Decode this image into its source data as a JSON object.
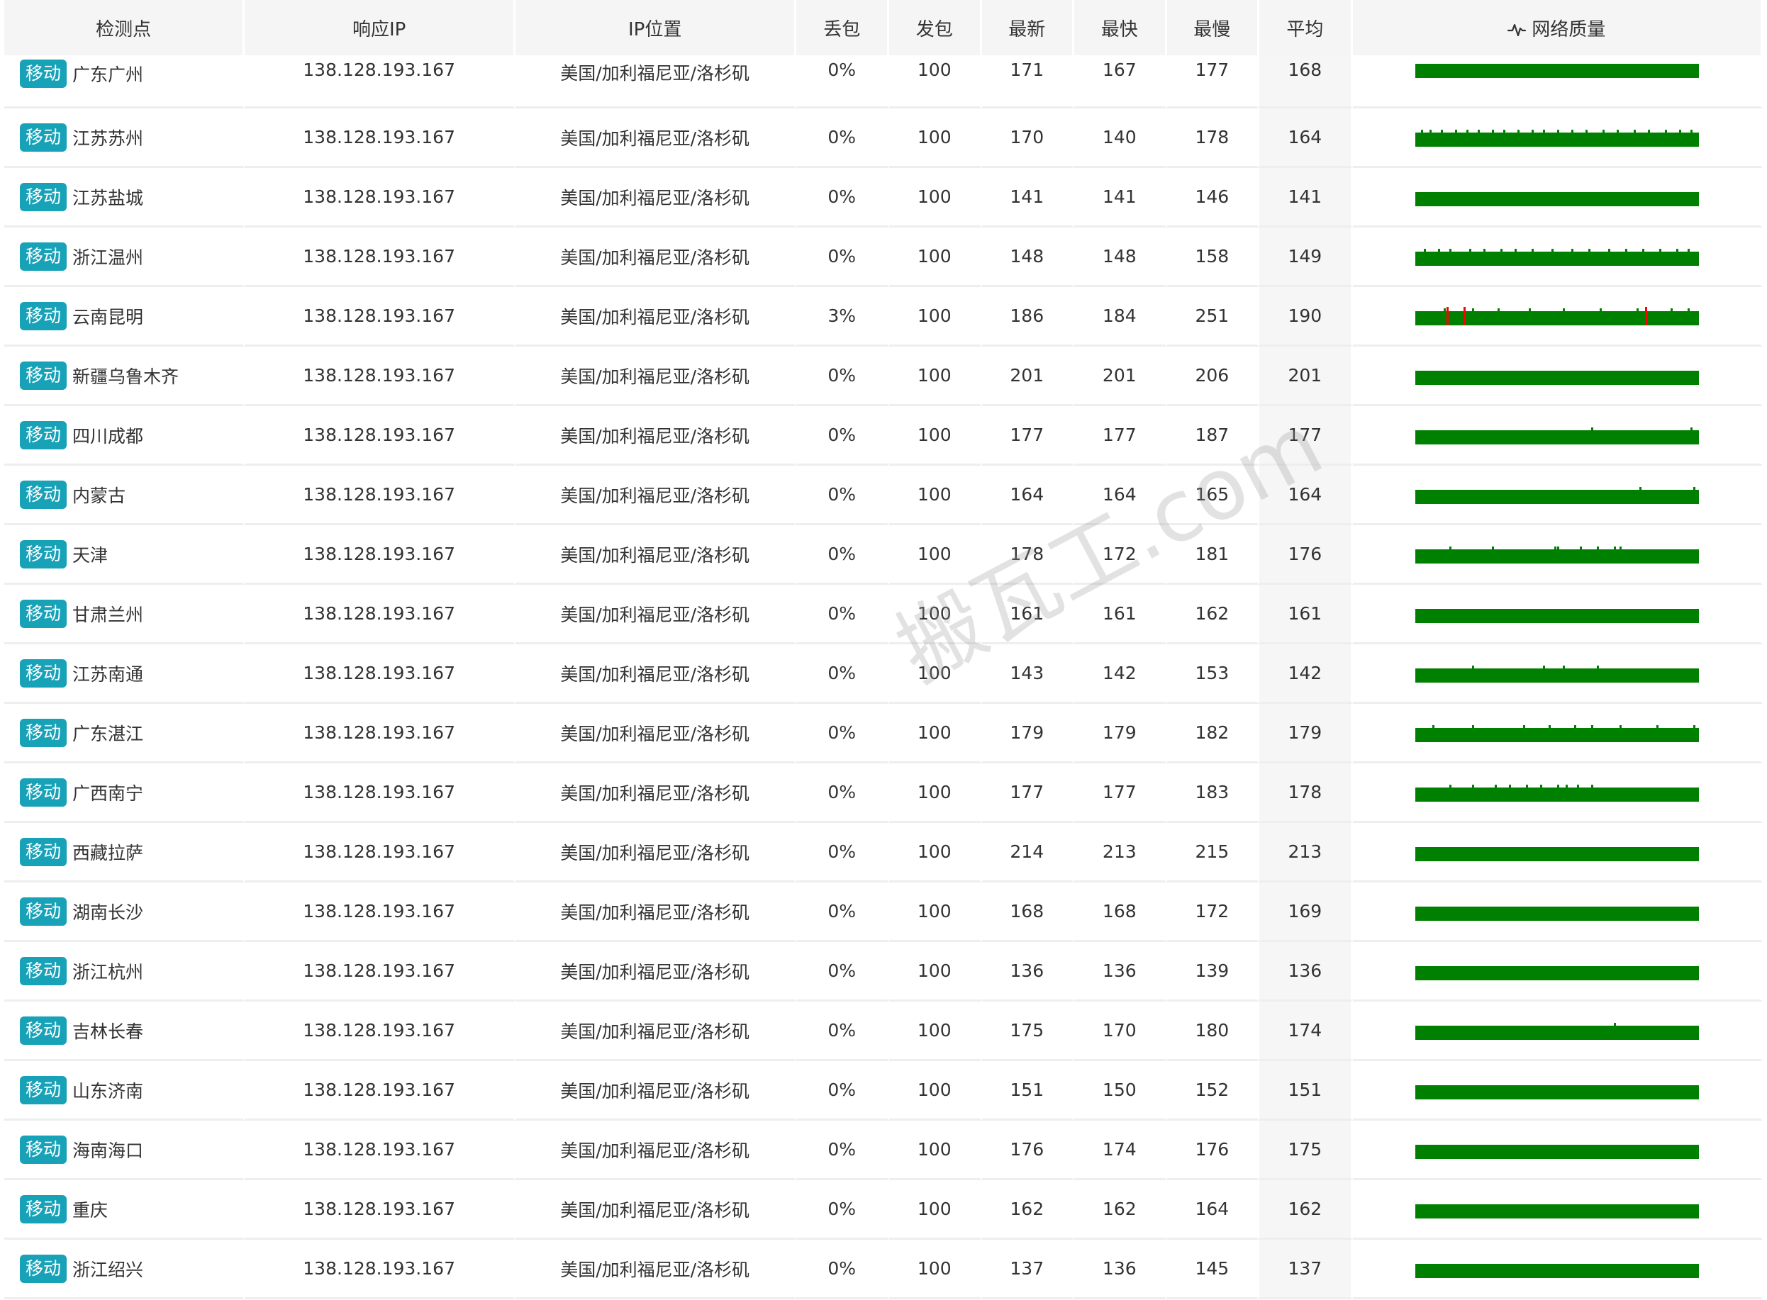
{
  "headers": {
    "node": "检测点",
    "ip": "响应IP",
    "location": "IP位置",
    "loss": "丢包",
    "sent": "发包",
    "latest": "最新",
    "fastest": "最快",
    "slowest": "最慢",
    "average": "平均",
    "quality": "网络质量"
  },
  "icons": {
    "quality_header": "pulse-icon"
  },
  "colors": {
    "badge": "#17a2b8",
    "ok": "#008000",
    "loss": "#ff0000"
  },
  "watermark": "搬瓦工.com",
  "rows": [
    {
      "isp": "移动",
      "node": "广东广州",
      "ip": "138.128.193.167",
      "loc": "美国/加利福尼亚/洛杉矶",
      "loss": "0%",
      "sent": "100",
      "latest": "171",
      "fastest": "167",
      "slowest": "177",
      "avg": "168",
      "spikes": [],
      "lost": []
    },
    {
      "isp": "移动",
      "node": "江苏苏州",
      "ip": "138.128.193.167",
      "loc": "美国/加利福尼亚/洛杉矶",
      "loss": "0%",
      "sent": "100",
      "latest": "170",
      "fastest": "140",
      "slowest": "178",
      "avg": "164",
      "spikes": [
        0.02,
        0.05,
        0.09,
        0.14,
        0.18,
        0.22,
        0.27,
        0.31,
        0.36,
        0.41,
        0.45,
        0.5,
        0.55,
        0.6,
        0.66,
        0.71,
        0.77,
        0.82,
        0.88,
        0.93,
        0.97
      ],
      "lost": []
    },
    {
      "isp": "移动",
      "node": "江苏盐城",
      "ip": "138.128.193.167",
      "loc": "美国/加利福尼亚/洛杉矶",
      "loss": "0%",
      "sent": "100",
      "latest": "141",
      "fastest": "141",
      "slowest": "146",
      "avg": "141",
      "spikes": [],
      "lost": []
    },
    {
      "isp": "移动",
      "node": "浙江温州",
      "ip": "138.128.193.167",
      "loc": "美国/加利福尼亚/洛杉矶",
      "loss": "0%",
      "sent": "100",
      "latest": "148",
      "fastest": "148",
      "slowest": "158",
      "avg": "149",
      "spikes": [
        0.03,
        0.08,
        0.12,
        0.19,
        0.24,
        0.3,
        0.35,
        0.41,
        0.48,
        0.55,
        0.61,
        0.68,
        0.74,
        0.8,
        0.86,
        0.92,
        0.96
      ],
      "lost": []
    },
    {
      "isp": "移动",
      "node": "云南昆明",
      "ip": "138.128.193.167",
      "loc": "美国/加利福尼亚/洛杉矶",
      "loss": "3%",
      "sent": "100",
      "latest": "186",
      "fastest": "184",
      "slowest": "251",
      "avg": "190",
      "spikes": [
        0.1,
        0.2,
        0.29,
        0.4,
        0.52,
        0.65,
        0.78,
        0.9,
        0.96
      ],
      "lost": [
        0.11,
        0.17,
        0.81
      ]
    },
    {
      "isp": "移动",
      "node": "新疆乌鲁木齐",
      "ip": "138.128.193.167",
      "loc": "美国/加利福尼亚/洛杉矶",
      "loss": "0%",
      "sent": "100",
      "latest": "201",
      "fastest": "201",
      "slowest": "206",
      "avg": "201",
      "spikes": [],
      "lost": []
    },
    {
      "isp": "移动",
      "node": "四川成都",
      "ip": "138.128.193.167",
      "loc": "美国/加利福尼亚/洛杉矶",
      "loss": "0%",
      "sent": "100",
      "latest": "177",
      "fastest": "177",
      "slowest": "187",
      "avg": "177",
      "spikes": [
        0.62,
        0.97
      ],
      "lost": []
    },
    {
      "isp": "移动",
      "node": "内蒙古",
      "ip": "138.128.193.167",
      "loc": "美国/加利福尼亚/洛杉矶",
      "loss": "0%",
      "sent": "100",
      "latest": "164",
      "fastest": "164",
      "slowest": "165",
      "avg": "164",
      "spikes": [
        0.79,
        0.98
      ],
      "lost": []
    },
    {
      "isp": "移动",
      "node": "天津",
      "ip": "138.128.193.167",
      "loc": "美国/加利福尼亚/洛杉矶",
      "loss": "0%",
      "sent": "100",
      "latest": "178",
      "fastest": "172",
      "slowest": "181",
      "avg": "176",
      "spikes": [
        0.12,
        0.27,
        0.49,
        0.5,
        0.58,
        0.64,
        0.7,
        0.72
      ],
      "lost": []
    },
    {
      "isp": "移动",
      "node": "甘肃兰州",
      "ip": "138.128.193.167",
      "loc": "美国/加利福尼亚/洛杉矶",
      "loss": "0%",
      "sent": "100",
      "latest": "161",
      "fastest": "161",
      "slowest": "162",
      "avg": "161",
      "spikes": [],
      "lost": []
    },
    {
      "isp": "移动",
      "node": "江苏南通",
      "ip": "138.128.193.167",
      "loc": "美国/加利福尼亚/洛杉矶",
      "loss": "0%",
      "sent": "100",
      "latest": "143",
      "fastest": "142",
      "slowest": "153",
      "avg": "142",
      "spikes": [
        0.2,
        0.45,
        0.52,
        0.64
      ],
      "lost": []
    },
    {
      "isp": "移动",
      "node": "广东湛江",
      "ip": "138.128.193.167",
      "loc": "美国/加利福尼亚/洛杉矶",
      "loss": "0%",
      "sent": "100",
      "latest": "179",
      "fastest": "179",
      "slowest": "182",
      "avg": "179",
      "spikes": [
        0.06,
        0.2,
        0.38,
        0.47,
        0.56,
        0.62,
        0.72,
        0.85,
        0.98
      ],
      "lost": []
    },
    {
      "isp": "移动",
      "node": "广西南宁",
      "ip": "138.128.193.167",
      "loc": "美国/加利福尼亚/洛杉矶",
      "loss": "0%",
      "sent": "100",
      "latest": "177",
      "fastest": "177",
      "slowest": "183",
      "avg": "178",
      "spikes": [
        0.12,
        0.2,
        0.28,
        0.33,
        0.39,
        0.44,
        0.5,
        0.53,
        0.57,
        0.62
      ],
      "lost": []
    },
    {
      "isp": "移动",
      "node": "西藏拉萨",
      "ip": "138.128.193.167",
      "loc": "美国/加利福尼亚/洛杉矶",
      "loss": "0%",
      "sent": "100",
      "latest": "214",
      "fastest": "213",
      "slowest": "215",
      "avg": "213",
      "spikes": [],
      "lost": []
    },
    {
      "isp": "移动",
      "node": "湖南长沙",
      "ip": "138.128.193.167",
      "loc": "美国/加利福尼亚/洛杉矶",
      "loss": "0%",
      "sent": "100",
      "latest": "168",
      "fastest": "168",
      "slowest": "172",
      "avg": "169",
      "spikes": [],
      "lost": []
    },
    {
      "isp": "移动",
      "node": "浙江杭州",
      "ip": "138.128.193.167",
      "loc": "美国/加利福尼亚/洛杉矶",
      "loss": "0%",
      "sent": "100",
      "latest": "136",
      "fastest": "136",
      "slowest": "139",
      "avg": "136",
      "spikes": [],
      "lost": []
    },
    {
      "isp": "移动",
      "node": "吉林长春",
      "ip": "138.128.193.167",
      "loc": "美国/加利福尼亚/洛杉矶",
      "loss": "0%",
      "sent": "100",
      "latest": "175",
      "fastest": "170",
      "slowest": "180",
      "avg": "174",
      "spikes": [
        0.7
      ],
      "lost": []
    },
    {
      "isp": "移动",
      "node": "山东济南",
      "ip": "138.128.193.167",
      "loc": "美国/加利福尼亚/洛杉矶",
      "loss": "0%",
      "sent": "100",
      "latest": "151",
      "fastest": "150",
      "slowest": "152",
      "avg": "151",
      "spikes": [],
      "lost": []
    },
    {
      "isp": "移动",
      "node": "海南海口",
      "ip": "138.128.193.167",
      "loc": "美国/加利福尼亚/洛杉矶",
      "loss": "0%",
      "sent": "100",
      "latest": "176",
      "fastest": "174",
      "slowest": "176",
      "avg": "175",
      "spikes": [],
      "lost": []
    },
    {
      "isp": "移动",
      "node": "重庆",
      "ip": "138.128.193.167",
      "loc": "美国/加利福尼亚/洛杉矶",
      "loss": "0%",
      "sent": "100",
      "latest": "162",
      "fastest": "162",
      "slowest": "164",
      "avg": "162",
      "spikes": [],
      "lost": []
    },
    {
      "isp": "移动",
      "node": "浙江绍兴",
      "ip": "138.128.193.167",
      "loc": "美国/加利福尼亚/洛杉矶",
      "loss": "0%",
      "sent": "100",
      "latest": "137",
      "fastest": "136",
      "slowest": "145",
      "avg": "137",
      "spikes": [],
      "lost": []
    }
  ]
}
